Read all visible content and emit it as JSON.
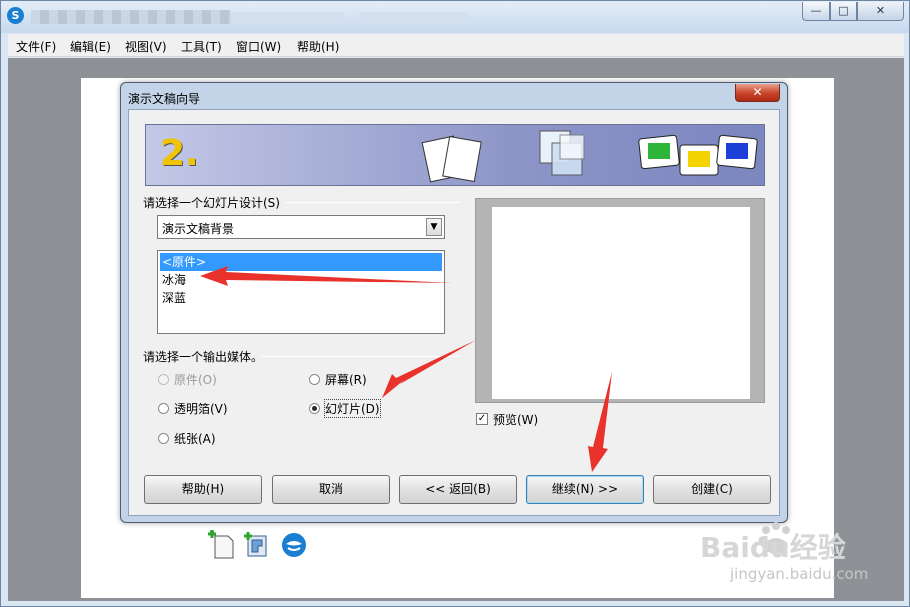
{
  "menubar": {
    "items": [
      "文件(F)",
      "编辑(E)",
      "视图(V)",
      "工具(T)",
      "窗口(W)",
      "帮助(H)"
    ]
  },
  "dialog": {
    "title": "演示文稿向导",
    "close": "✕",
    "step": "2.",
    "design_group_label": "请选择一个幻灯片设计(S)",
    "design_combo_value": "演示文稿背景",
    "design_list": [
      "<原件>",
      "冰海",
      "深蓝"
    ],
    "design_list_selected": 0,
    "media_group_label": "请选择一个输出媒体。",
    "media_options": {
      "original": "原件(O)",
      "screen": "屏幕(R)",
      "transparency": "透明箔(V)",
      "slide": "幻灯片(D)",
      "paper": "纸张(A)"
    },
    "media_selected": "slide",
    "preview_label": "预览(W)",
    "preview_checked": true,
    "buttons": {
      "help": "帮助(H)",
      "cancel": "取消",
      "back": "<< 返回(B)",
      "next": "继续(N) >>",
      "create": "创建(C)"
    }
  },
  "watermark": {
    "brand": "Baidu经验",
    "url": "jingyan.baidu.com"
  },
  "colors": {
    "accent_selected": "#3399ff",
    "annotation_arrow": "#e8322b"
  }
}
